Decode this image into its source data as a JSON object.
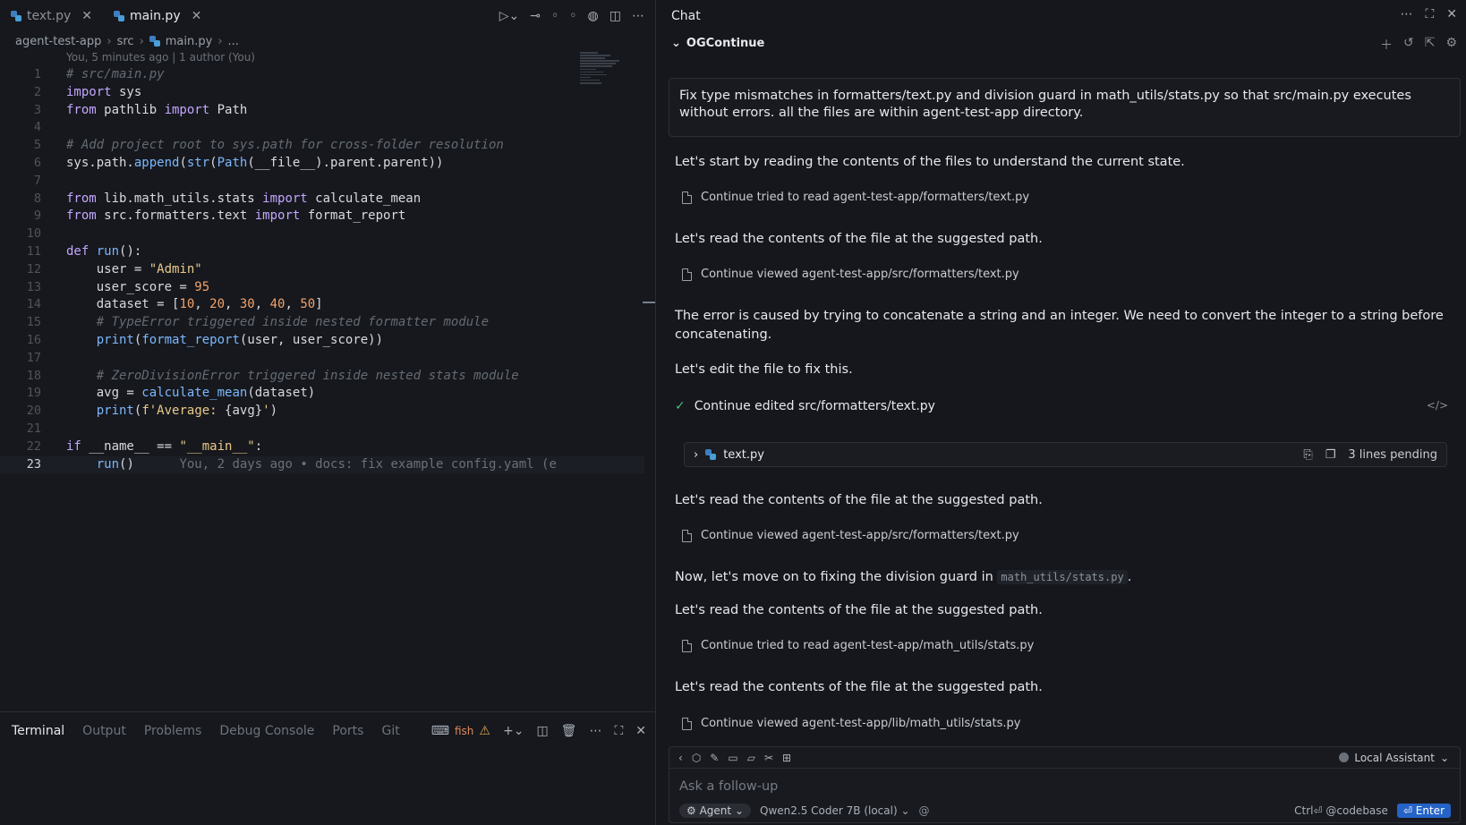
{
  "editor": {
    "tabs": [
      {
        "label": "text.py",
        "active": false
      },
      {
        "label": "main.py",
        "active": true
      }
    ],
    "breadcrumb": [
      "agent-test-app",
      "src",
      "main.py",
      "..."
    ],
    "blame_header": "You, 5 minutes ago | 1 author (You)",
    "inline_blame": "You, 2 days ago • docs: fix example config.yaml (e",
    "current_line": 23
  },
  "panel": {
    "tabs": [
      "Terminal",
      "Output",
      "Problems",
      "Debug Console",
      "Ports",
      "Git"
    ],
    "active_tab": "Terminal",
    "shell_label": "fish"
  },
  "chat": {
    "title": "Chat",
    "session_name": "OGContinue",
    "user_prompt": "Fix type mismatches in formatters/text.py and division guard in math_utils/stats.py so that src/main.py executes without errors. all the files are within agent-test-app directory.",
    "messages": {
      "m1": "Let's start by reading the contents of the files to understand the current state.",
      "t1": "Continue tried to read agent-test-app/formatters/text.py",
      "m2": "Let's read the contents of the file at the suggested path.",
      "t2": "Continue viewed agent-test-app/src/formatters/text.py",
      "m3": "The error is caused by trying to concatenate a string and an integer. We need to convert the integer to a string before concatenating.",
      "m4": "Let's edit the file to fix this.",
      "edited": "Continue edited src/formatters/text.py",
      "diff_file": "text.py",
      "diff_pending": "3 lines pending",
      "m5": "Let's read the contents of the file at the suggested path.",
      "t3": "Continue viewed agent-test-app/src/formatters/text.py",
      "m6_prefix": "Now, let's move on to fixing the division guard in ",
      "m6_code": "math_utils/stats.py",
      "m6_suffix": ".",
      "m7": "Let's read the contents of the file at the suggested path.",
      "t4": "Continue tried to read agent-test-app/math_utils/stats.py",
      "m8": "Let's read the contents of the file at the suggested path.",
      "t5": "Continue viewed agent-test-app/lib/math_utils/stats.py"
    },
    "input": {
      "assistant": "Local Assistant",
      "placeholder": "Ask a follow-up",
      "mode": "Agent",
      "model": "Qwen2.5 Coder 7B (local)",
      "at_symbol": "@",
      "hint": "Ctrl⏎ @codebase",
      "enter_label": "⏎ Enter"
    }
  },
  "colors": {
    "keyword": "#c3a6ff",
    "function": "#7cb7ff",
    "string": "#e9c98a",
    "number": "#f2a36b",
    "comment": "#646a74",
    "accent": "#2563c7",
    "success": "#4dbb7a"
  }
}
